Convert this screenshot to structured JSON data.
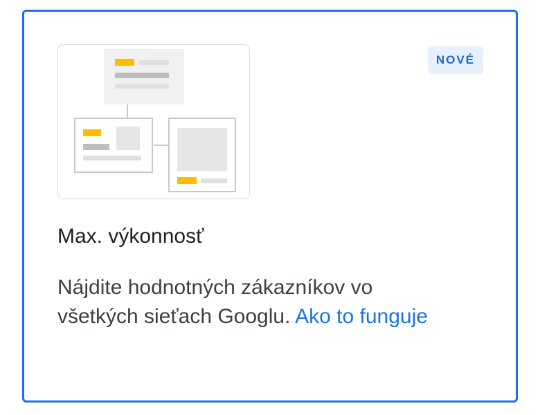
{
  "card": {
    "badge": "NOVÉ",
    "title": "Max. výkonnosť",
    "description": "Nájdite hodnotných zákazníkov vo všetkých sieťach Googlu.",
    "link_text": "Ako to funguje"
  },
  "illustration": {
    "icon": "campaign-network-illustration"
  },
  "colors": {
    "selection_border": "#1a73e8",
    "accent_yellow": "#fbbc04",
    "badge_background": "#e8f0fe",
    "badge_text": "#1967d2",
    "link": "#1a73e8"
  }
}
